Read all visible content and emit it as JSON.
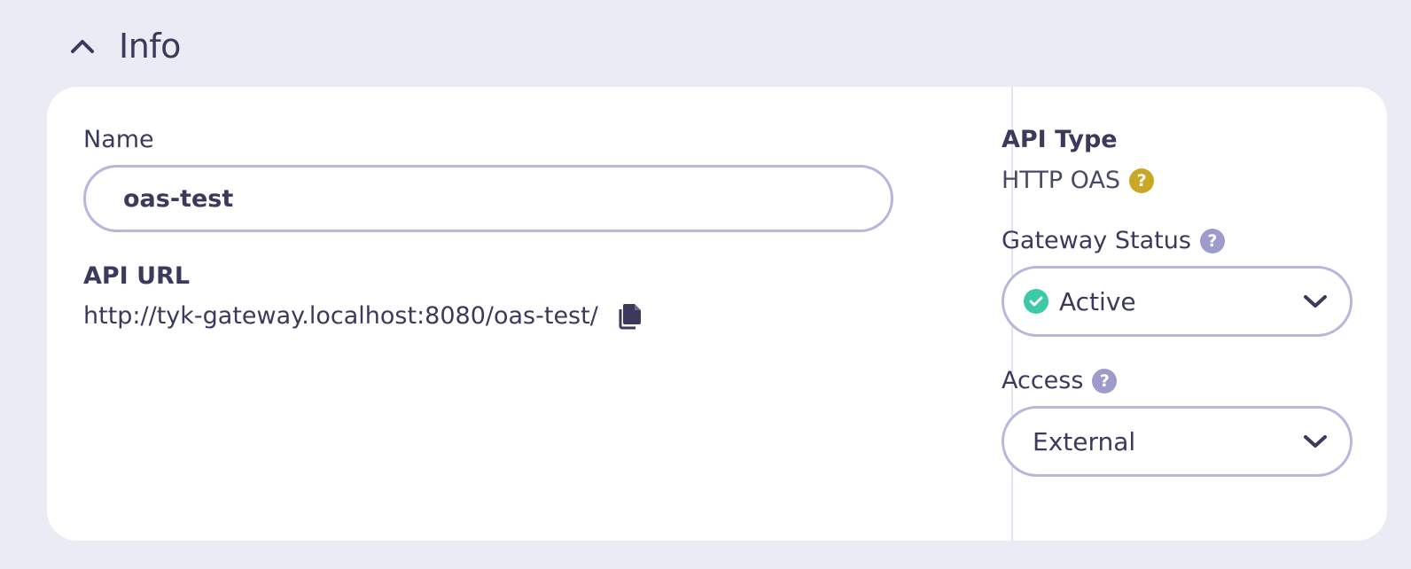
{
  "section": {
    "title": "Info"
  },
  "left": {
    "name_label": "Name",
    "name_value": "oas-test",
    "url_label": "API URL",
    "url_value": "http://tyk-gateway.localhost:8080/oas-test/"
  },
  "right": {
    "api_type_label": "API Type",
    "api_type_value": "HTTP OAS",
    "gateway_status_label": "Gateway Status",
    "gateway_status_value": "Active",
    "access_label": "Access",
    "access_value": "External"
  },
  "colors": {
    "background": "#ebebf6",
    "card": "#ffffff",
    "text": "#3b3a5c",
    "border": "#b7b6dc",
    "help_gold": "#c9a727",
    "help_purple": "#9d9bcc",
    "status_active": "#3cc9a6"
  },
  "icons": {
    "collapse": "chevron-up-icon",
    "copy": "copy-icon",
    "help": "question-circle-icon",
    "status": "check-circle-icon",
    "dropdown": "chevron-down-icon"
  }
}
